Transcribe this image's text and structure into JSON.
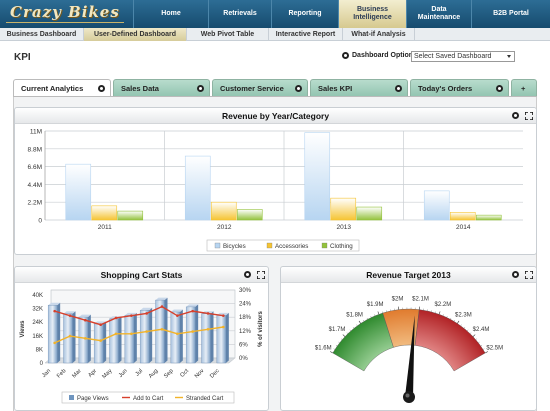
{
  "app": {
    "logo": "Crazy Bikes"
  },
  "nav": [
    {
      "label": "Home"
    },
    {
      "label": "Retrievals"
    },
    {
      "label": "Reporting"
    },
    {
      "label": "Business Intelligence"
    },
    {
      "label": "Data Maintenance"
    },
    {
      "label": "B2B Portal"
    }
  ],
  "subnav": [
    {
      "label": "Business Dashboard"
    },
    {
      "label": "User-Defined Dashboard"
    },
    {
      "label": "Web Pivot Table"
    },
    {
      "label": "Interactive Report"
    },
    {
      "label": "What-if Analysis"
    }
  ],
  "page": {
    "title": "KPI",
    "dashboard_options_label": "Dashboard Options",
    "select_placeholder": "Select Saved Dashboard"
  },
  "tabs": [
    {
      "label": "Current Analytics"
    },
    {
      "label": "Sales Data"
    },
    {
      "label": "Customer Service"
    },
    {
      "label": "Sales KPI"
    },
    {
      "label": "Today's Orders"
    },
    {
      "label": "+"
    }
  ],
  "panels": {
    "revenue": {
      "title": "Revenue by Year/Category"
    },
    "cart": {
      "title": "Shopping Cart Stats"
    },
    "target": {
      "title": "Revenue Target 2013"
    }
  },
  "colors": {
    "bicycles": "#b7d5f1",
    "accessories": "#f5c433",
    "clothing": "#93c23c",
    "page_views": "#6f95bf",
    "add_to_cart": "#d7402c",
    "stranded_cart": "#f2b32a",
    "gauge_green": "#2f8a2e",
    "gauge_orange": "#e07b2e",
    "gauge_red": "#b12225"
  },
  "chart_data": [
    {
      "type": "bar",
      "title": "Revenue by Year/Category",
      "categories": [
        "2011",
        "2012",
        "2013",
        "2014"
      ],
      "ylim": [
        0,
        11000000
      ],
      "yticks": [
        "0",
        "2.2M",
        "4.4M",
        "6.6M",
        "8.8M",
        "11M"
      ],
      "series": [
        {
          "name": "Bicycles",
          "values": [
            6900000,
            7900000,
            10800000,
            3600000
          ]
        },
        {
          "name": "Accessories",
          "values": [
            1750000,
            2200000,
            2700000,
            950000
          ]
        },
        {
          "name": "Clothing",
          "values": [
            1100000,
            1300000,
            1600000,
            600000
          ]
        }
      ],
      "grid": true,
      "legend": "bottom"
    },
    {
      "type": "bar",
      "title": "Shopping Cart Stats",
      "categories": [
        "Jan",
        "Feb",
        "Mar",
        "Apr",
        "May",
        "Jun",
        "Jul",
        "Aug",
        "Sep",
        "Oct",
        "Nov",
        "Dec"
      ],
      "ylabel": "Views",
      "y2label": "% of visitors",
      "ylim": [
        0,
        40000
      ],
      "yticks": [
        "0",
        "8K",
        "16K",
        "24K",
        "32K",
        "40K"
      ],
      "y2lim": [
        0,
        30
      ],
      "y2ticks": [
        "0%",
        "6%",
        "12%",
        "18%",
        "24%",
        "30%"
      ],
      "series": [
        {
          "name": "Page Views",
          "type": "bar",
          "values": [
            34000,
            29000,
            27000,
            23000,
            26000,
            28000,
            31000,
            37000,
            30000,
            33000,
            29000,
            28000
          ]
        },
        {
          "name": "Add to Cart",
          "type": "line",
          "values": [
            22,
            20,
            18,
            16,
            19,
            20,
            21,
            24,
            20,
            22,
            21,
            20
          ]
        },
        {
          "name": "Stranded Cart",
          "type": "line",
          "values": [
            8,
            11,
            10,
            9,
            12,
            12,
            13,
            14,
            12,
            13,
            14,
            15
          ]
        }
      ],
      "grid": true,
      "legend": "bottom"
    },
    {
      "type": "gauge",
      "title": "Revenue Target 2013",
      "range": [
        1.6,
        2.5
      ],
      "tick_labels": [
        "$1.6M",
        "$1.7M",
        "$1.8M",
        "$1.9M",
        "$2M",
        "$2.1M",
        "$2.2M",
        "$2.3M",
        "$2.4M",
        "$2.5M"
      ],
      "bands": [
        {
          "from": 1.6,
          "to": 1.92,
          "color": "green"
        },
        {
          "from": 1.92,
          "to": 2.1,
          "color": "orange"
        },
        {
          "from": 2.1,
          "to": 2.5,
          "color": "red"
        }
      ],
      "value": 2.08
    }
  ]
}
